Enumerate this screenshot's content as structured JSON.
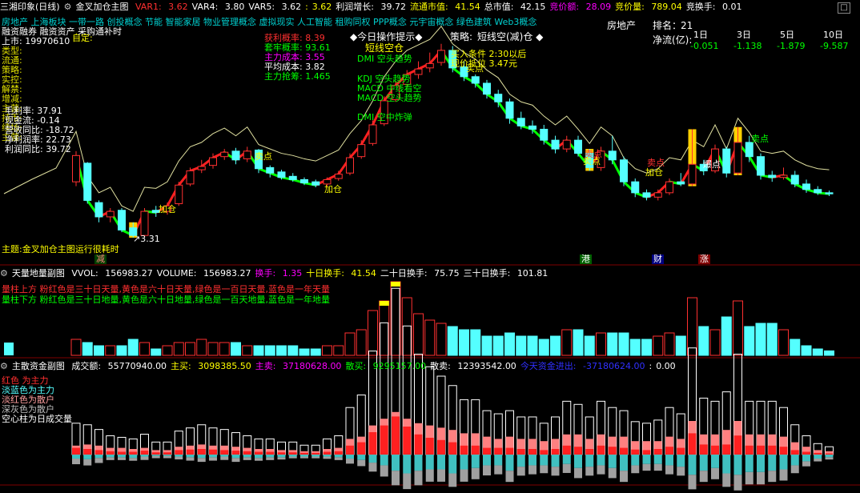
{
  "colors": {
    "bg": "#000000",
    "up": "#ff3030",
    "down": "#54ffff",
    "grid": "#800000",
    "white": "#ffffff",
    "yellow": "#ffff00",
    "green": "#00ff00",
    "magenta": "#ff00ff"
  },
  "main_header": {
    "stock": "三湘印象(日线)",
    "indicator": "金叉加仓主图",
    "items": [
      {
        "k": "VAR1: ",
        "v": "3.62"
      },
      {
        "k": "VAR4: ",
        "v": "3.80"
      },
      {
        "k": "VAR5: ",
        "v": "3.62"
      },
      {
        "k": ":",
        "v": "3.62"
      },
      {
        "k": "利润增长: ",
        "v": "39.72"
      },
      {
        "k": "流通市值: ",
        "v": "41.54"
      },
      {
        "k": "总市值: ",
        "v": "42.15"
      },
      {
        "k": "竞价额: ",
        "v": "28.09"
      },
      {
        "k": "竞价量: ",
        "v": "789.04"
      },
      {
        "k": "竞换手: ",
        "v": "0.01"
      }
    ]
  },
  "sector_tags": "房地产 上海板块 一带一路 创投概念 节能 智能家居 物业管理概念 虚拟现实 人工智能 租购同权 PPP概念 元宇宙概念 绿色建筑 Web3概念",
  "left_labels": [
    "融资融券 融资资产 采购通补时",
    "上市: 19970610",
    "类型:",
    "流通:",
    "策略:",
    "实控:",
    "解禁:",
    "增减:",
    "主营:",
    "持币:",
    "续场:",
    "主营:"
  ],
  "left_stats": [
    {
      "k": "毛利率: ",
      "v": "37.91"
    },
    {
      "k": "现金流: ",
      "v": "-0.14"
    },
    {
      "k": "营收同比: ",
      "v": "-18.72"
    },
    {
      "k": "净利润率: ",
      "v": "22.73"
    },
    {
      "k": "利润同比: ",
      "v": "39.72"
    }
  ],
  "left_custom": "自定:",
  "winloss": [
    {
      "k": "获利概率: ",
      "v": "8.39"
    },
    {
      "k": "套牢概率: ",
      "v": "93.61"
    },
    {
      "k": "主力成本: ",
      "v": "3.55"
    },
    {
      "k": "平均成本: ",
      "v": "3.82"
    },
    {
      "k": "主力抢筹: ",
      "v": "1.465"
    }
  ],
  "today_tip": "◆今日操作提示◆",
  "strategy_label": "策略:",
  "strategy": "短线空(减)仓 ◆",
  "signals": [
    "短线空仓",
    "DMI 空头趋势",
    "KDJ 空头趋势",
    "MACD 中线看空",
    "MACD 空头趋势",
    "DMI 空中炸弹"
  ],
  "buy_cond": [
    "买入条件 2:30以后",
    "现价抵位 3.47元"
  ],
  "chart_marks": [
    "加仓",
    "卖点",
    "加仓",
    "卖点",
    "卖点",
    "加仓",
    "卖点",
    "爆点",
    "卖点",
    "买点"
  ],
  "low_label": "3.31",
  "bottom_note": "主题:金叉加仓主图运行很耗时",
  "event_tags": [
    "减",
    "港",
    "财",
    "涨"
  ],
  "flow_panel": {
    "title": "房地产",
    "rank_label": "排名：",
    "rank": "21",
    "net_label": "净流(亿):",
    "days": [
      "1日",
      "3日",
      "5日",
      "10日"
    ],
    "values": [
      "-0.051",
      "-1.138",
      "-1.879",
      "-9.587"
    ]
  },
  "vol_header": {
    "title": "天量地量副图",
    "items": [
      {
        "k": "VVOL: ",
        "v": "156983.27"
      },
      {
        "k": "VOLUME: ",
        "v": "156983.27"
      },
      {
        "k": "换手: ",
        "v": "1.35"
      },
      {
        "k": "十日换手: ",
        "v": "41.54"
      },
      {
        "k": "二十日换手: ",
        "v": "75.75"
      },
      {
        "k": "三十日换手: ",
        "v": "101.81"
      }
    ]
  },
  "vol_legend": [
    "量柱上方 粉红色是三十日天量,黄色是六十日天量,绿色是一百日天量,蓝色是一年天量",
    "量柱下方 粉红色是三十日地量,黄色是六十日地量,绿色是一百天地量,蓝色是一年地量"
  ],
  "fund_header": {
    "title": "主散资金副图",
    "items": [
      {
        "k": "成交额: ",
        "v": "55770940.00"
      },
      {
        "k": "主买: ",
        "v": "3098385.50"
      },
      {
        "k": "主卖: ",
        "v": "37180628.00"
      },
      {
        "k": "散买: ",
        "v": "9295157.00"
      },
      {
        "k": "散卖: ",
        "v": "12393542.00"
      },
      {
        "k": "今天资金进出: ",
        "v": "-37180624.00"
      },
      {
        "k": ":",
        "v": "0.00"
      }
    ]
  },
  "fund_legend": [
    "红色 为主力",
    "淡蓝色为主力",
    "淡红色为散户",
    "深灰色为散户",
    "空心柱为日成交量"
  ],
  "candles": [
    [
      3.82,
      4.06,
      4.1,
      3.78
    ],
    [
      3.99,
      3.65,
      4.0,
      3.62
    ],
    [
      3.63,
      3.5,
      3.65,
      3.45
    ],
    [
      3.5,
      3.55,
      3.58,
      3.45
    ],
    [
      3.56,
      3.38,
      3.58,
      3.36
    ],
    [
      3.4,
      3.33,
      3.45,
      3.31
    ],
    [
      3.33,
      3.55,
      3.58,
      3.31
    ],
    [
      3.56,
      3.54,
      3.6,
      3.5
    ],
    [
      3.55,
      3.6,
      3.63,
      3.52
    ],
    [
      3.62,
      3.79,
      3.82,
      3.6
    ],
    [
      3.8,
      3.92,
      3.95,
      3.78
    ],
    [
      3.93,
      3.96,
      4.02,
      3.9
    ],
    [
      3.97,
      4.04,
      4.08,
      3.94
    ],
    [
      4.05,
      4.09,
      4.12,
      4.02
    ],
    [
      4.1,
      4.02,
      4.13,
      3.98
    ],
    [
      4.03,
      4.1,
      4.14,
      4.0
    ],
    [
      4.11,
      3.94,
      4.12,
      3.9
    ],
    [
      3.95,
      3.9,
      3.97,
      3.86
    ],
    [
      3.91,
      3.86,
      3.93,
      3.84
    ],
    [
      3.87,
      3.84,
      3.9,
      3.82
    ],
    [
      3.84,
      3.81,
      3.86,
      3.79
    ],
    [
      3.82,
      3.79,
      3.84,
      3.77
    ],
    [
      3.8,
      3.84,
      3.86,
      3.78
    ],
    [
      3.85,
      3.89,
      3.92,
      3.83
    ],
    [
      3.9,
      4.04,
      4.08,
      3.88
    ],
    [
      4.05,
      4.16,
      4.2,
      4.03
    ],
    [
      4.17,
      4.34,
      4.38,
      4.15
    ],
    [
      4.35,
      4.56,
      4.6,
      4.33
    ],
    [
      4.57,
      4.7,
      4.74,
      4.55
    ],
    [
      4.71,
      4.8,
      4.84,
      4.68
    ],
    [
      4.8,
      4.85,
      4.92,
      4.76
    ],
    [
      4.86,
      4.9,
      5.0,
      4.82
    ],
    [
      4.91,
      5.02,
      5.08,
      4.88
    ],
    [
      5.02,
      4.86,
      5.06,
      4.82
    ],
    [
      4.87,
      4.78,
      4.92,
      4.74
    ],
    [
      4.78,
      4.72,
      4.8,
      4.68
    ],
    [
      4.72,
      4.62,
      4.75,
      4.58
    ],
    [
      4.62,
      4.55,
      4.66,
      4.5
    ],
    [
      4.55,
      4.4,
      4.58,
      4.35
    ],
    [
      4.4,
      4.33,
      4.46,
      4.3
    ],
    [
      4.33,
      4.3,
      4.38,
      4.26
    ],
    [
      4.3,
      4.2,
      4.34,
      4.16
    ],
    [
      4.2,
      4.12,
      4.24,
      4.08
    ],
    [
      4.12,
      4.2,
      4.24,
      4.09
    ],
    [
      4.2,
      4.08,
      4.24,
      4.05
    ],
    [
      4.08,
      3.95,
      4.12,
      3.92
    ],
    [
      3.95,
      4.1,
      4.14,
      3.92
    ],
    [
      4.1,
      4.02,
      4.24,
      3.98
    ],
    [
      4.02,
      3.82,
      4.05,
      3.78
    ],
    [
      3.82,
      3.72,
      3.85,
      3.68
    ],
    [
      3.72,
      3.68,
      3.75,
      3.65
    ],
    [
      3.68,
      3.72,
      3.75,
      3.65
    ],
    [
      3.72,
      3.82,
      3.85,
      3.7
    ],
    [
      3.82,
      3.8,
      3.9,
      3.78
    ],
    [
      3.8,
      3.98,
      4.3,
      3.78
    ],
    [
      3.98,
      3.92,
      4.02,
      3.88
    ],
    [
      3.92,
      4.12,
      4.16,
      3.9
    ],
    [
      4.12,
      3.9,
      4.14,
      3.86
    ],
    [
      3.9,
      4.18,
      4.32,
      3.88
    ],
    [
      4.18,
      4.05,
      4.24,
      4.0
    ],
    [
      4.05,
      3.88,
      4.08,
      3.84
    ],
    [
      3.88,
      3.86,
      3.92,
      3.82
    ],
    [
      3.86,
      3.88,
      3.95,
      3.84
    ],
    [
      3.88,
      3.8,
      3.92,
      3.77
    ],
    [
      3.8,
      3.75,
      3.84,
      3.72
    ],
    [
      3.75,
      3.72,
      3.78,
      3.7
    ],
    [
      3.72,
      3.71,
      3.74,
      3.69
    ]
  ],
  "volumes": [
    5,
    4,
    3,
    3,
    3,
    5,
    4,
    2,
    3,
    4,
    4,
    5,
    4,
    4,
    4,
    3,
    3,
    3,
    3,
    3,
    2,
    2,
    3,
    3,
    7,
    8,
    14,
    17,
    23,
    18,
    13,
    11,
    10,
    9,
    8,
    8,
    6,
    6,
    7,
    6,
    6,
    5,
    6,
    8,
    8,
    6,
    7,
    7,
    7,
    5,
    5,
    6,
    7,
    6,
    18,
    9,
    8,
    12,
    17,
    9,
    10,
    10,
    8,
    5,
    3,
    2,
    1.4
  ],
  "fund": [
    [
      1.2,
      0.6,
      0.8,
      1.0
    ],
    [
      1.0,
      0.7,
      0.9,
      1.1
    ],
    [
      0.8,
      0.5,
      0.8,
      0.9
    ],
    [
      0.6,
      0.4,
      0.6,
      0.5
    ],
    [
      0.5,
      0.4,
      0.6,
      0.5
    ],
    [
      0.5,
      0.5,
      0.5,
      0.5
    ],
    [
      0.7,
      0.3,
      0.6,
      0.6
    ],
    [
      0.4,
      0.2,
      0.4,
      0.4
    ],
    [
      0.4,
      0.2,
      0.4,
      0.4
    ],
    [
      0.8,
      0.3,
      0.7,
      0.5
    ],
    [
      0.9,
      0.4,
      0.8,
      0.6
    ],
    [
      1.0,
      0.5,
      0.9,
      0.7
    ],
    [
      0.9,
      0.4,
      0.8,
      0.6
    ],
    [
      0.8,
      0.3,
      0.8,
      0.6
    ],
    [
      0.7,
      0.5,
      0.7,
      0.7
    ],
    [
      0.6,
      0.4,
      0.6,
      0.5
    ],
    [
      0.5,
      0.5,
      0.5,
      0.5
    ],
    [
      0.5,
      0.4,
      0.5,
      0.5
    ],
    [
      0.4,
      0.4,
      0.4,
      0.4
    ],
    [
      0.4,
      0.3,
      0.4,
      0.3
    ],
    [
      0.3,
      0.3,
      0.3,
      0.3
    ],
    [
      0.3,
      0.3,
      0.3,
      0.3
    ],
    [
      0.5,
      0.3,
      0.5,
      0.4
    ],
    [
      0.6,
      0.4,
      0.6,
      0.5
    ],
    [
      1.6,
      0.6,
      1.4,
      0.9
    ],
    [
      2.2,
      0.8,
      1.6,
      1.1
    ],
    [
      4.0,
      1.2,
      2.6,
      1.6
    ],
    [
      5.2,
      1.6,
      3.2,
      2.0
    ],
    [
      6.8,
      2.4,
      3.8,
      2.6
    ],
    [
      5.0,
      2.8,
      3.2,
      2.8
    ],
    [
      3.6,
      2.4,
      2.8,
      2.6
    ],
    [
      3.0,
      2.2,
      2.6,
      2.2
    ],
    [
      2.6,
      2.2,
      2.4,
      2.2
    ],
    [
      2.2,
      2.8,
      2.2,
      2.4
    ],
    [
      1.6,
      2.2,
      1.9,
      2.2
    ],
    [
      1.6,
      2.0,
      1.9,
      2.0
    ],
    [
      1.2,
      1.6,
      1.6,
      1.8
    ],
    [
      1.2,
      1.6,
      1.4,
      1.6
    ],
    [
      1.2,
      2.4,
      1.6,
      2.0
    ],
    [
      1.0,
      1.8,
      1.4,
      1.6
    ],
    [
      1.0,
      1.6,
      1.4,
      1.6
    ],
    [
      0.8,
      1.6,
      1.2,
      1.4
    ],
    [
      1.0,
      1.8,
      1.4,
      1.6
    ],
    [
      1.6,
      1.4,
      1.8,
      1.6
    ],
    [
      1.4,
      2.0,
      1.8,
      1.8
    ],
    [
      1.0,
      1.8,
      1.4,
      1.6
    ],
    [
      1.6,
      1.6,
      1.8,
      1.6
    ],
    [
      1.4,
      2.0,
      1.6,
      1.8
    ],
    [
      1.2,
      2.4,
      1.6,
      2.0
    ],
    [
      0.9,
      1.6,
      1.2,
      1.4
    ],
    [
      0.8,
      1.4,
      1.2,
      1.2
    ],
    [
      1.0,
      1.4,
      1.2,
      1.2
    ],
    [
      1.4,
      1.6,
      1.6,
      1.6
    ],
    [
      1.2,
      1.8,
      1.4,
      1.6
    ],
    [
      3.8,
      3.0,
      3.0,
      2.6
    ],
    [
      1.8,
      2.4,
      1.8,
      2.0
    ],
    [
      1.6,
      2.0,
      1.8,
      2.0
    ],
    [
      1.8,
      2.8,
      2.2,
      2.4
    ],
    [
      3.4,
      3.0,
      3.0,
      2.8
    ],
    [
      1.6,
      2.6,
      1.8,
      2.2
    ],
    [
      1.6,
      2.6,
      1.8,
      2.2
    ],
    [
      1.6,
      2.4,
      1.8,
      2.0
    ],
    [
      1.4,
      2.2,
      1.6,
      2.0
    ],
    [
      0.8,
      1.6,
      1.1,
      1.4
    ],
    [
      0.5,
      1.0,
      0.7,
      0.9
    ],
    [
      0.3,
      0.6,
      0.4,
      0.5
    ],
    [
      0.2,
      0.4,
      0.3,
      0.4
    ]
  ]
}
